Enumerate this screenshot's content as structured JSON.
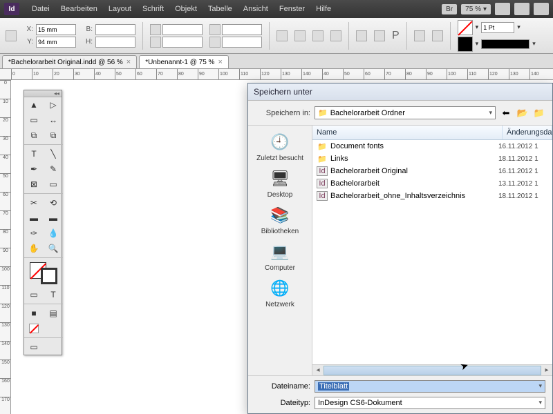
{
  "app": {
    "logo": "Id"
  },
  "menu": {
    "items": [
      "Datei",
      "Bearbeiten",
      "Layout",
      "Schrift",
      "Objekt",
      "Tabelle",
      "Ansicht",
      "Fenster",
      "Hilfe"
    ],
    "br_label": "Br",
    "zoom": "75 %"
  },
  "control": {
    "x_label": "X:",
    "x_value": "15 mm",
    "y_label": "Y:",
    "y_value": "94 mm",
    "w_label": "B:",
    "w_value": "",
    "h_label": "H:",
    "h_value": "",
    "stroke_weight": "1 Pt"
  },
  "tabs": [
    {
      "label": "*Bachelorarbeit Original.indd @ 56 %"
    },
    {
      "label": "*Unbenannt-1 @ 75 %"
    }
  ],
  "ruler_h": [
    "0",
    "10",
    "20",
    "30",
    "40",
    "50",
    "60",
    "70",
    "80",
    "90",
    "100",
    "110",
    "120",
    "130",
    "140",
    "40",
    "50",
    "60",
    "70",
    "80",
    "90",
    "100",
    "110",
    "120",
    "130",
    "140"
  ],
  "ruler_v": [
    "0",
    "10",
    "20",
    "30",
    "40",
    "50",
    "60",
    "70",
    "80",
    "90",
    "100",
    "110",
    "120",
    "130",
    "140",
    "150",
    "160",
    "170"
  ],
  "dialog": {
    "title": "Speichern unter",
    "save_in_label": "Speichern in:",
    "save_in_value": "Bachelorarbeit Ordner",
    "places": [
      {
        "icon": "🕘",
        "label": "Zuletzt besucht"
      },
      {
        "icon": "🖥",
        "label": "Desktop"
      },
      {
        "icon": "📚",
        "label": "Bibliotheken"
      },
      {
        "icon": "💻",
        "label": "Computer"
      },
      {
        "icon": "🌐",
        "label": "Netzwerk"
      }
    ],
    "columns": {
      "name": "Name",
      "modified": "Änderungsdatum"
    },
    "files": [
      {
        "type": "folder",
        "name": "Document fonts",
        "date": "16.11.2012 1"
      },
      {
        "type": "folder",
        "name": "Links",
        "date": "18.11.2012 1"
      },
      {
        "type": "indd",
        "name": "Bachelorarbeit Original",
        "date": "16.11.2012 1"
      },
      {
        "type": "indd",
        "name": "Bachelorarbeit",
        "date": "13.11.2012 1"
      },
      {
        "type": "indd",
        "name": "Bachelorarbeit_ohne_Inhaltsverzeichnis",
        "date": "18.11.2012 1"
      }
    ],
    "filename_label": "Dateiname:",
    "filename_value": "Titelblatt",
    "filetype_label": "Dateityp:",
    "filetype_value": "InDesign CS6-Dokument"
  }
}
